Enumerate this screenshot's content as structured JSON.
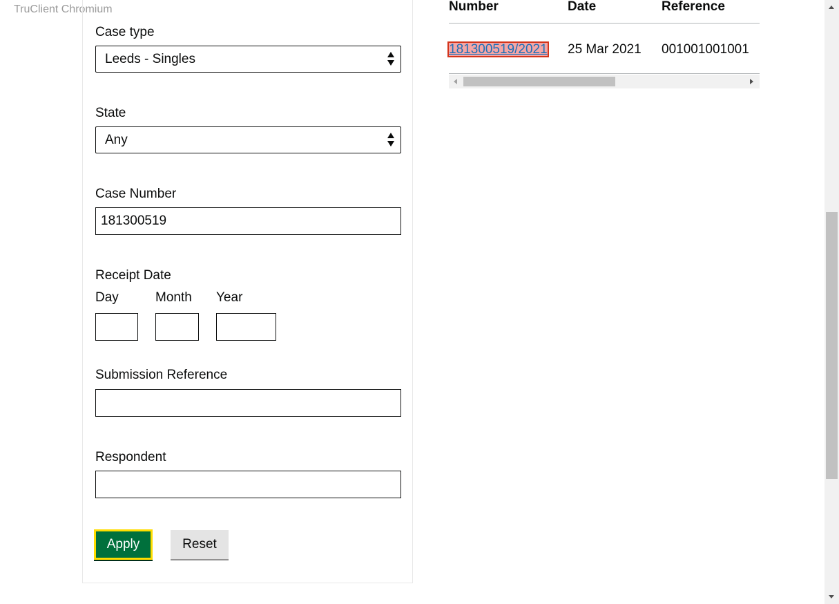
{
  "watermark": "TruClient Chromium",
  "filters": {
    "case_type": {
      "label": "Case type",
      "value": "Leeds - Singles"
    },
    "state": {
      "label": "State",
      "value": "Any"
    },
    "case_number": {
      "label": "Case Number",
      "value": "181300519"
    },
    "receipt_date": {
      "label": "Receipt Date",
      "day_label": "Day",
      "month_label": "Month",
      "year_label": "Year",
      "day_value": "",
      "month_value": "",
      "year_value": ""
    },
    "submission_reference": {
      "label": "Submission Reference",
      "value": ""
    },
    "respondent": {
      "label": "Respondent",
      "value": ""
    },
    "apply_label": "Apply",
    "reset_label": "Reset"
  },
  "results": {
    "columns": [
      "Number",
      "Date",
      "Reference"
    ],
    "rows": [
      {
        "number": "181300519/2021",
        "date": "25 Mar 2021",
        "reference": "001001001001"
      }
    ]
  },
  "colors": {
    "apply_button": "#00703c",
    "focus": "#ffdd00",
    "link": "#1d70b8",
    "highlight": "#f4a6a6"
  }
}
